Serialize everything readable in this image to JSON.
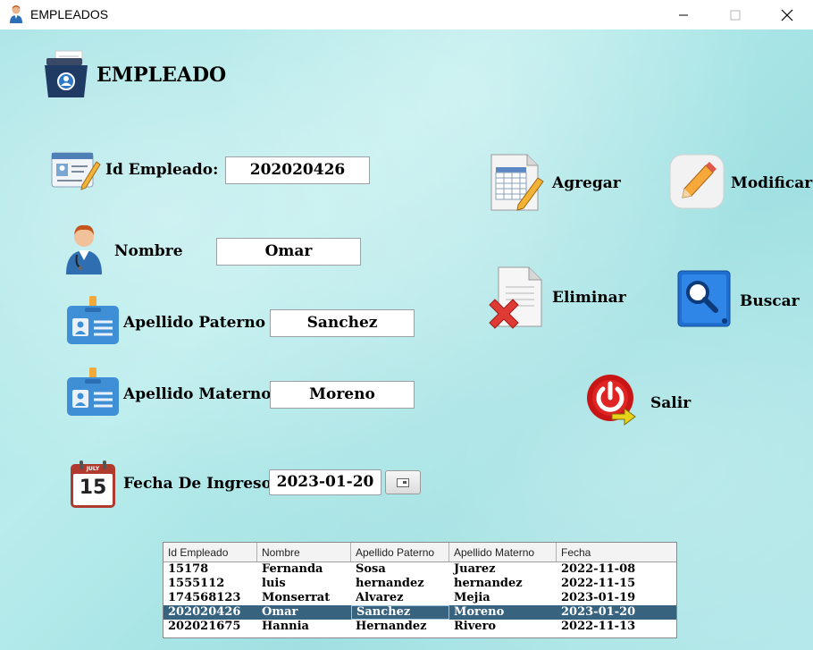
{
  "window": {
    "title": "EMPLEADOS"
  },
  "form": {
    "heading": "EMPLEADO",
    "id_label": "Id Empleado:",
    "id_value": "202020426",
    "nombre_label": "Nombre",
    "nombre_value": "Omar",
    "apellido_paterno_label": "Apellido Paterno",
    "apellido_paterno_value": "Sanchez",
    "apellido_materno_label": "Apellido Materno",
    "apellido_materno_value": "Moreno",
    "fecha_label": "Fecha De Ingreso:",
    "fecha_value": "2023-01-20",
    "calendar_month": "JULY",
    "calendar_day": "15"
  },
  "actions": {
    "agregar": "Agregar",
    "modificar": "Modificar",
    "eliminar": "Eliminar",
    "buscar": "Buscar",
    "salir": "Salir"
  },
  "table": {
    "columns": [
      "Id Empleado",
      "Nombre",
      "Apellido Paterno",
      "Apellido Materno",
      "Fecha"
    ],
    "rows": [
      [
        "15178",
        "Fernanda",
        "Sosa",
        "Juarez",
        "2022-11-08"
      ],
      [
        "1555112",
        "luis",
        "hernandez",
        "hernandez",
        "2022-11-15"
      ],
      [
        "174568123",
        "Monserrat",
        "Alvarez",
        "Mejia",
        "2023-01-19"
      ],
      [
        "202020426",
        "Omar",
        "Sanchez",
        "Moreno",
        "2023-01-20"
      ],
      [
        "202021675",
        "Hannia",
        "Hernandez",
        "Rivero",
        "2022-11-13"
      ]
    ],
    "selected_row": 3
  },
  "colors": {
    "background": "#a8e4e6",
    "selection": "#38637f"
  },
  "icons": {
    "app": "employee-icon",
    "heading": "folder-user-icon",
    "id": "id-card-pencil-icon",
    "nombre": "doctor-user-icon",
    "apellido_paterno": "badge-icon",
    "apellido_materno": "badge-icon",
    "fecha": "calendar-icon",
    "agregar": "spreadsheet-pencil-icon",
    "modificar": "pencil-icon",
    "eliminar": "document-delete-icon",
    "buscar": "search-book-icon",
    "salir": "power-exit-icon"
  }
}
